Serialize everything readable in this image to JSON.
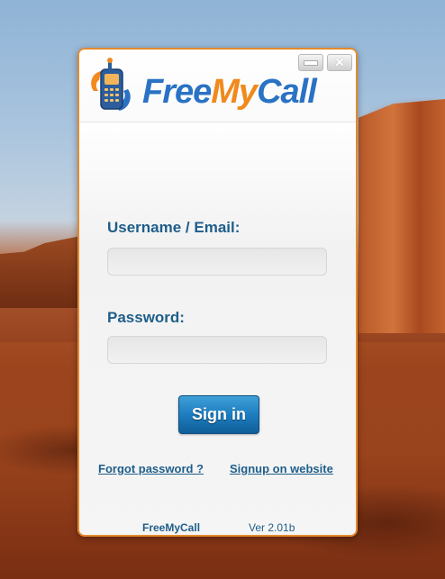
{
  "window": {
    "minimize_icon": "minimize-icon",
    "close_icon": "close-icon",
    "close_glyph": "✕"
  },
  "logo": {
    "icon": "phone-logo-icon",
    "part1": "Free",
    "part2": "My",
    "part3": "Call"
  },
  "form": {
    "username_label": "Username / Email:",
    "username_value": "",
    "password_label": "Password:",
    "password_value": "",
    "signin_label": "Sign in"
  },
  "links": {
    "forgot": "Forgot password ?",
    "signup": "Signup on website"
  },
  "footer": {
    "app_name": "FreeMyCall",
    "version": "Ver 2.01b"
  },
  "colors": {
    "accent_blue": "#1f5e8a",
    "brand_orange": "#f08a1c",
    "window_border": "#e38a2e"
  }
}
